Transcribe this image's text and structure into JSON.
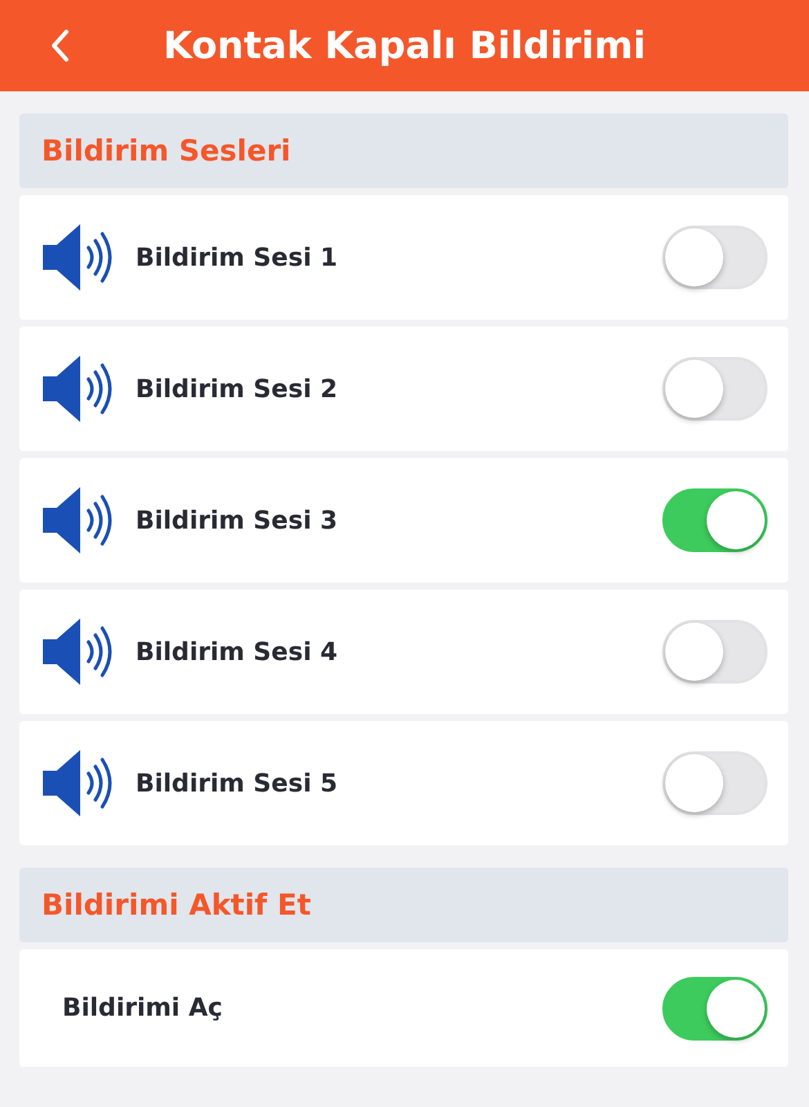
{
  "header": {
    "title": "Kontak Kapalı Bildirimi"
  },
  "sections": [
    {
      "title": "Bildirim Sesleri",
      "rows": [
        {
          "kind": "sound",
          "label": "Bildirim Sesi 1",
          "on": false
        },
        {
          "kind": "sound",
          "label": "Bildirim Sesi 2",
          "on": false
        },
        {
          "kind": "sound",
          "label": "Bildirim Sesi 3",
          "on": true
        },
        {
          "kind": "sound",
          "label": "Bildirim Sesi 4",
          "on": false
        },
        {
          "kind": "sound",
          "label": "Bildirim Sesi 5",
          "on": false
        }
      ]
    },
    {
      "title": "Bildirimi Aktif Et",
      "rows": [
        {
          "kind": "plain",
          "label": "Bildirimi Aç",
          "on": true
        }
      ]
    }
  ]
}
